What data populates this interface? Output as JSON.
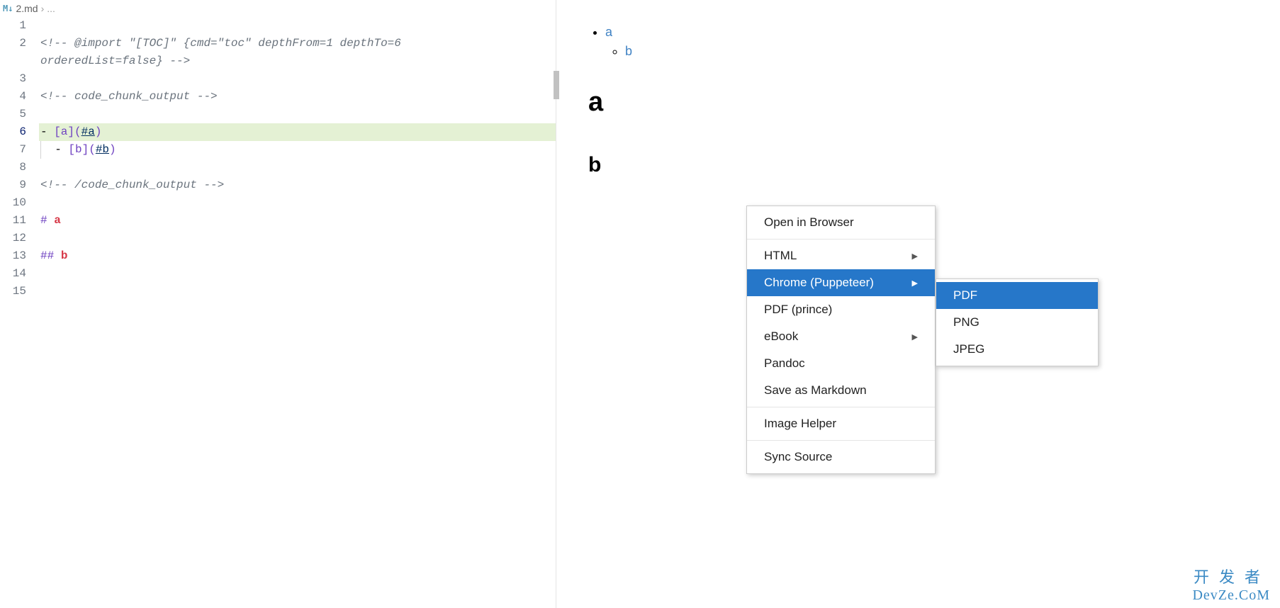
{
  "breadcrumb": {
    "icon_label": "M↓",
    "filename": "2.md",
    "separator": "›",
    "rest": "..."
  },
  "editor": {
    "lines": [
      {
        "n": "1",
        "html": ""
      },
      {
        "n": "2",
        "html": "<span class='c-gray'>&lt;!-- @import \"[TOC]\" {cmd=\"toc\" depthFrom=1 depthTo=6 </span>"
      },
      {
        "n": "",
        "html": "<span class='c-gray'>orderedList=false} --&gt;</span>",
        "cont": true
      },
      {
        "n": "3",
        "html": ""
      },
      {
        "n": "4",
        "html": "<span class='c-gray'>&lt;!-- code_chunk_output --&gt;</span>"
      },
      {
        "n": "5",
        "html": ""
      },
      {
        "n": "6",
        "html": "- <span class='c-punct'>[a](</span><span class='c-link'>#a</span><span class='c-punct'>)</span>",
        "hl": true
      },
      {
        "n": "7",
        "html": "<span class='indent-guide'></span>  - <span class='c-punct'>[b](</span><span class='c-link'>#b</span><span class='c-punct'>)</span>"
      },
      {
        "n": "8",
        "html": ""
      },
      {
        "n": "9",
        "html": "<span class='c-gray'>&lt;!-- /code_chunk_output --&gt;</span>"
      },
      {
        "n": "10",
        "html": ""
      },
      {
        "n": "11",
        "html": "<span class='c-hash'>#</span> <span class='c-heading'>a</span>"
      },
      {
        "n": "12",
        "html": ""
      },
      {
        "n": "13",
        "html": "<span class='c-hash'>##</span> <span class='c-heading'>b</span>"
      },
      {
        "n": "14",
        "html": ""
      },
      {
        "n": "15",
        "html": ""
      }
    ]
  },
  "preview": {
    "toc": {
      "item1": "a",
      "item2": "b"
    },
    "h1": "a",
    "h2": "b"
  },
  "context_menu": {
    "items": [
      {
        "label": "Open in Browser",
        "sub": false
      },
      {
        "sep": true
      },
      {
        "label": "HTML",
        "sub": true
      },
      {
        "label": "Chrome (Puppeteer)",
        "sub": true,
        "hl": true
      },
      {
        "label": "PDF (prince)",
        "sub": false
      },
      {
        "label": "eBook",
        "sub": true
      },
      {
        "label": "Pandoc",
        "sub": false
      },
      {
        "label": "Save as Markdown",
        "sub": false
      },
      {
        "sep": true
      },
      {
        "label": "Image Helper",
        "sub": false
      },
      {
        "sep": true
      },
      {
        "label": "Sync Source",
        "sub": false
      }
    ]
  },
  "sub_menu": {
    "items": [
      {
        "label": "PDF",
        "hl": true
      },
      {
        "label": "PNG"
      },
      {
        "label": "JPEG"
      }
    ]
  },
  "watermark": {
    "top": "开发者",
    "bottom": "DevZe.CoM"
  }
}
